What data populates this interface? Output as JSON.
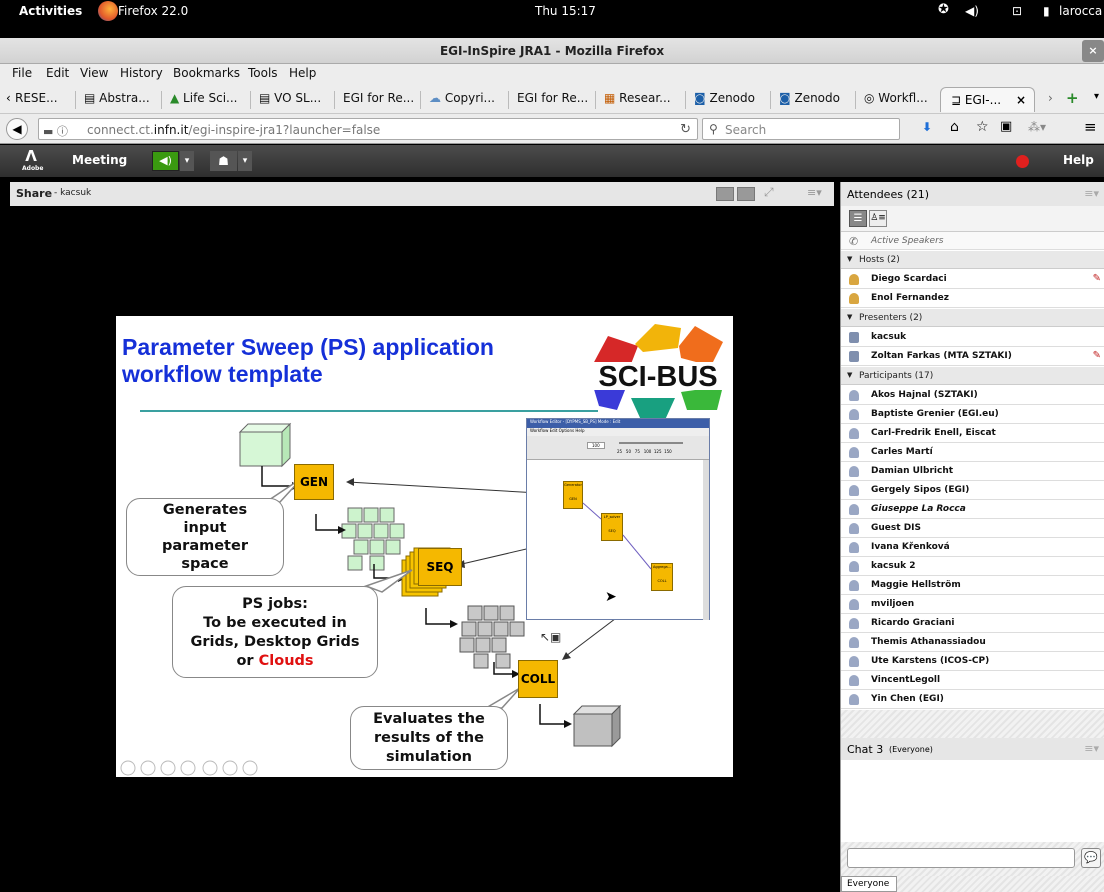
{
  "topbar": {
    "activities": "Activities",
    "app": "Firefox 22.0",
    "clock": "Thu 15:17",
    "user": "larocca"
  },
  "window": {
    "title": "EGI-InSpire JRA1 - Mozilla Firefox"
  },
  "menu": [
    "File",
    "Edit",
    "View",
    "History",
    "Bookmarks",
    "Tools",
    "Help"
  ],
  "bookmarks": [
    "RESE...",
    "Abstra...",
    "Life Sci...",
    "VO SL...",
    "EGI for Re...",
    "Copyri...",
    "EGI for Re...",
    "Resear...",
    "Zenodo",
    "Zenodo",
    "Workfl...",
    "EGI-..."
  ],
  "nav": {
    "url_host": "connect.ct.",
    "url_domain": "infn.it",
    "url_path": "/egi-inspire-jra1?launcher=false",
    "search_placeholder": "Search"
  },
  "meeting": {
    "logo_label": "Adobe",
    "menu": "Meeting",
    "help": "Help"
  },
  "share": {
    "title": "Share",
    "presenter": "- kacsuk"
  },
  "attendees": {
    "title": "Attendees (21)",
    "active_speakers": "Active Speakers",
    "hosts_label": "Hosts (2)",
    "hosts": [
      "Diego Scardaci",
      "Enol Fernandez"
    ],
    "presenters_label": "Presenters (2)",
    "presenters": [
      "kacsuk",
      "Zoltan Farkas (MTA SZTAKI)"
    ],
    "participants_label": "Participants (17)",
    "participants": [
      "Akos Hajnal (SZTAKI)",
      "Baptiste Grenier (EGI.eu)",
      "Carl-Fredrik Enell, Eiscat",
      "Carles Martí",
      "Damian Ulbricht",
      "Gergely Sipos (EGI)",
      "Giuseppe La Rocca",
      "Guest DIS",
      "Ivana Křenková",
      "kacsuk 2",
      "Maggie Hellström",
      "mviljoen",
      "Ricardo Graciani",
      "Themis Athanassiadou",
      "Ute Karstens (ICOS-CP)",
      "VincentLegoll",
      "Yin Chen (EGI)"
    ]
  },
  "chat": {
    "title": "Chat 3",
    "scope": "(Everyone)",
    "tab": "Everyone"
  },
  "slide": {
    "title_line1": "Parameter Sweep (PS) application",
    "title_line2": "workflow template",
    "logo": "SCI-BUS",
    "gen": "GEN",
    "seq": "SEQ",
    "coll": "COLL",
    "callout1": [
      "Generates",
      "input",
      "parameter",
      "space"
    ],
    "callout2_l1": "PS jobs:",
    "callout2_l2": "To be executed in",
    "callout2_l3": "Grids, Desktop Grids",
    "callout2_l4a": "or ",
    "callout2_l4b": "Clouds",
    "callout3": [
      "Evaluates the",
      "results of the",
      "simulation"
    ],
    "editor_title": "Workflow Editor - [DYPMS_SB_PS] Mode : Edit",
    "editor_menu": "Workflow  Edit  Options  Help",
    "editor_nodes": [
      "Generator",
      "GEN",
      "LP_solver",
      "SEQ",
      "Aggrega...",
      "COLL"
    ],
    "editor_scale": "25   50   75   100  125  150",
    "editor_zoom": "100"
  },
  "colors": {
    "slide_title": "#1530d8",
    "clouds": "#e01010",
    "job_box": "#f5b800",
    "green_cube": "#c8f0c8"
  }
}
